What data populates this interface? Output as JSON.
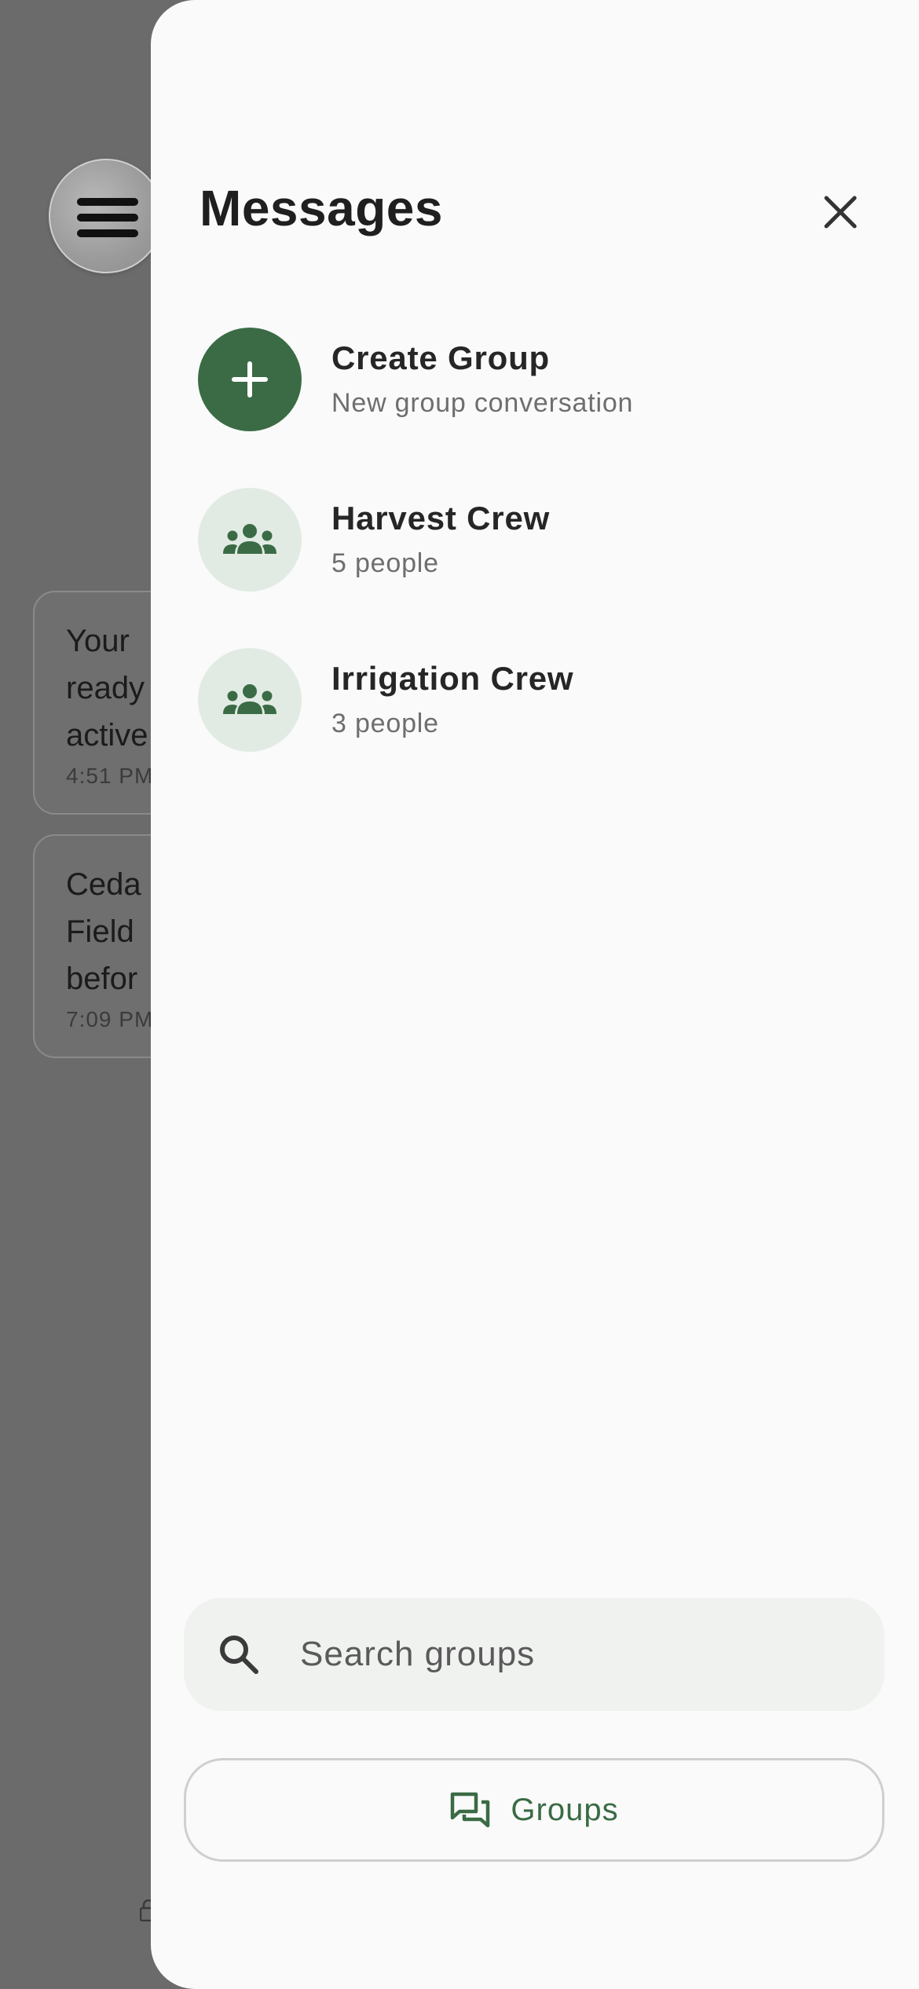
{
  "background": {
    "bubbles": [
      {
        "lines": [
          "Your ",
          "ready",
          "active"
        ],
        "time": "4:51 PM"
      },
      {
        "lines": [
          "Ceda",
          "Field ",
          "befor"
        ],
        "time": "7:09 PM"
      }
    ]
  },
  "drawer": {
    "title": "Messages",
    "create_group": {
      "title": "Create Group",
      "subtitle": "New group conversation"
    },
    "groups": [
      {
        "name": "Harvest Crew",
        "members": "5 people"
      },
      {
        "name": "Irrigation Crew",
        "members": "3 people"
      }
    ],
    "search": {
      "placeholder": "Search groups",
      "value": ""
    },
    "groups_button": {
      "label": "Groups",
      "icon": "chat-bubbles-icon"
    }
  },
  "colors": {
    "accent": "#3a6b45",
    "accent_soft": "#e1ebe3",
    "drawer_bg": "#fafafa",
    "overlay": "#6b6b6b"
  }
}
